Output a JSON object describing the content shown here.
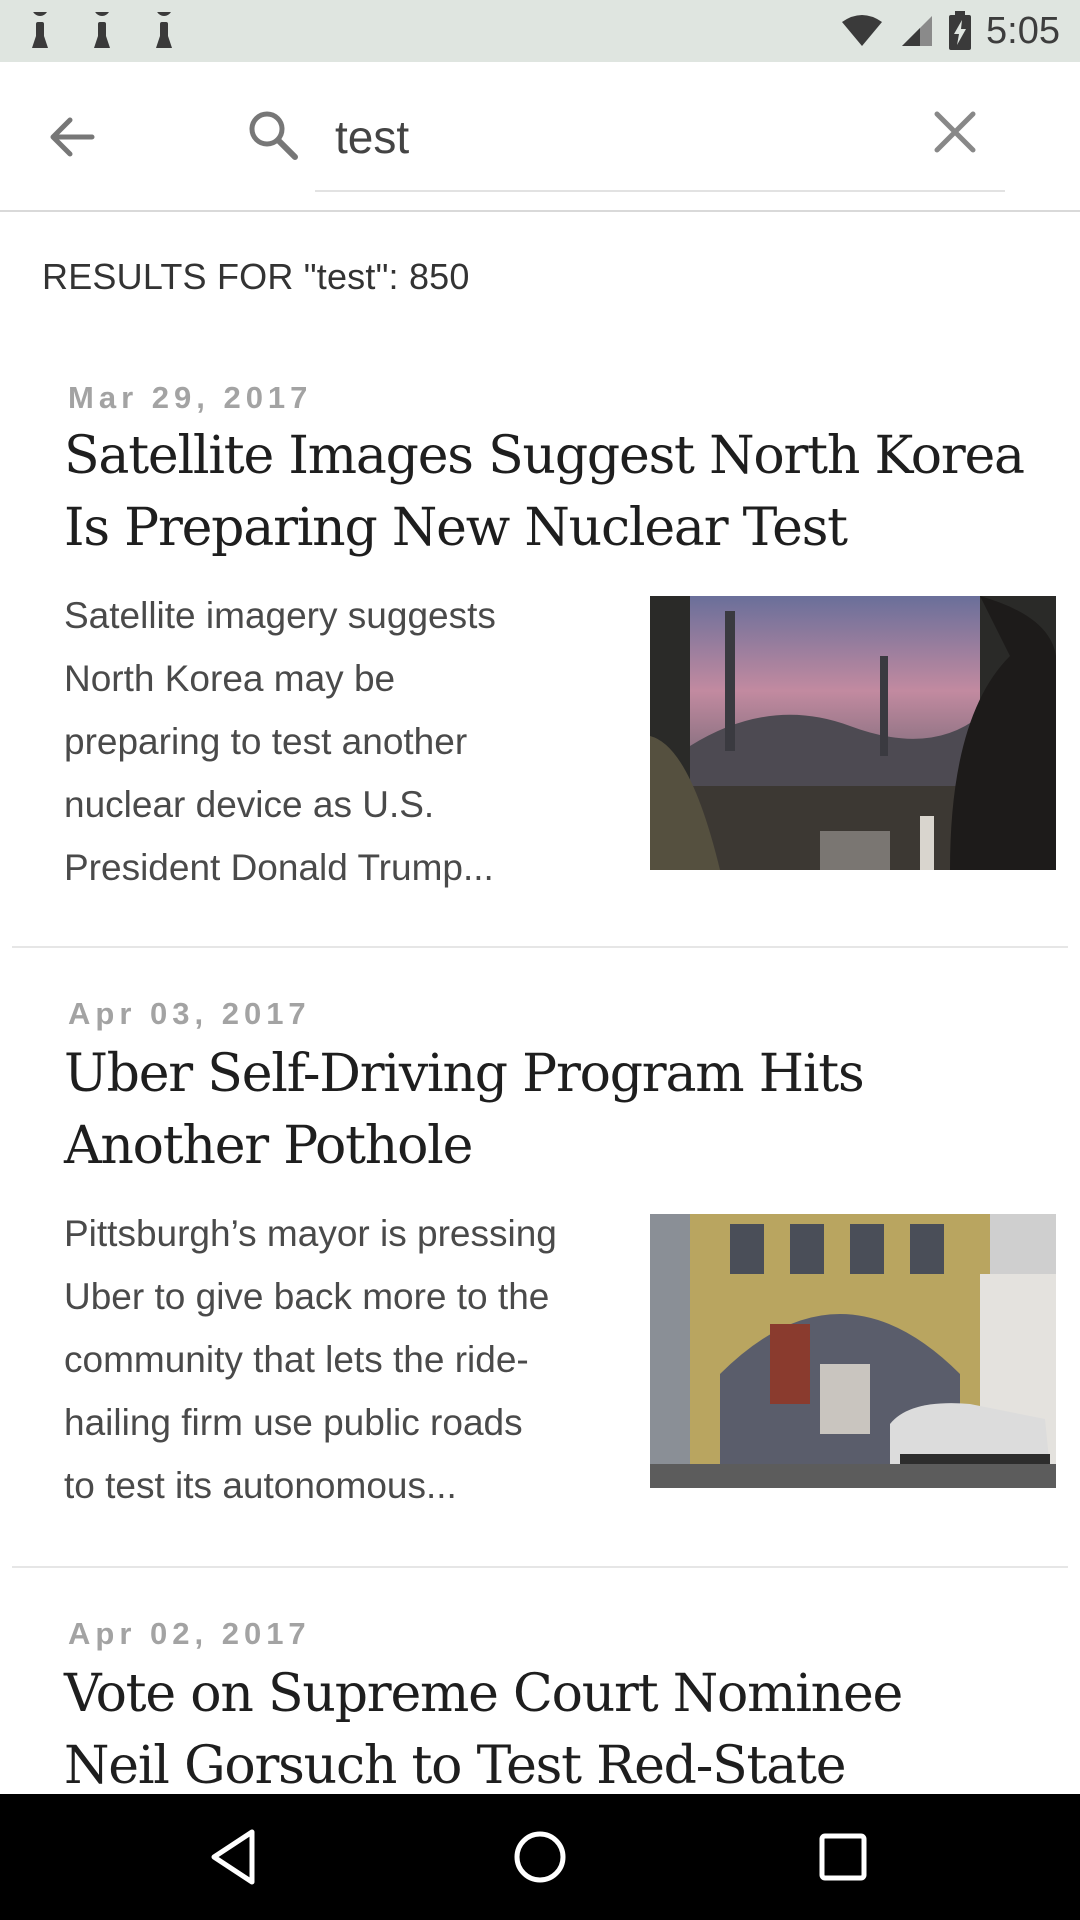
{
  "status_bar": {
    "time": "5:05",
    "icons": [
      "notification-icon",
      "notification-icon",
      "notification-icon",
      "wifi-icon",
      "signal-icon",
      "battery-charging-icon"
    ]
  },
  "search": {
    "value": "test",
    "back_icon": "back-arrow-icon",
    "search_icon": "search-icon",
    "clear_icon": "close-icon"
  },
  "results": {
    "label": "RESULTS FOR \"test\": 850"
  },
  "articles": [
    {
      "date": "Mar 29, 2017",
      "title": "Satellite Images Suggest North Korea Is Preparing New Nuclear Test",
      "summary": "Satellite imagery suggests North Korea may be preparing to test another nuclear device as U.S. President Donald Trump...",
      "summary_lines": [
        "Satellite imagery suggests",
        "North Korea may be",
        "preparing to test another",
        "nuclear device as U.S.",
        "President Donald Trump..."
      ],
      "title_lines": [
        "Satellite Images Suggest North Korea",
        "Is Preparing New Nuclear Test"
      ]
    },
    {
      "date": "Apr 03, 2017",
      "title": "Uber Self-Driving Program Hits Another Pothole",
      "summary": "Pittsburgh’s mayor is pressing Uber to give back more to the community that lets the ride-hailing firm use public roads to test its autonomous...",
      "summary_lines": [
        "Pittsburgh’s mayor is pressing",
        "Uber to give back more to the",
        "community that lets the ride-",
        "hailing firm use public roads",
        "to test its autonomous..."
      ],
      "title_lines": [
        "Uber Self-Driving Program Hits",
        "Another Pothole"
      ]
    },
    {
      "date": "Apr 02, 2017",
      "title": "Vote on Supreme Court Nominee Neil Gorsuch to Test Red-State",
      "title_lines": [
        "Vote on Supreme Court Nominee",
        "Neil Gorsuch to Test Red-State"
      ]
    }
  ],
  "nav_bar": {
    "icons": [
      "back-triangle-icon",
      "home-circle-icon",
      "recents-square-icon"
    ]
  }
}
